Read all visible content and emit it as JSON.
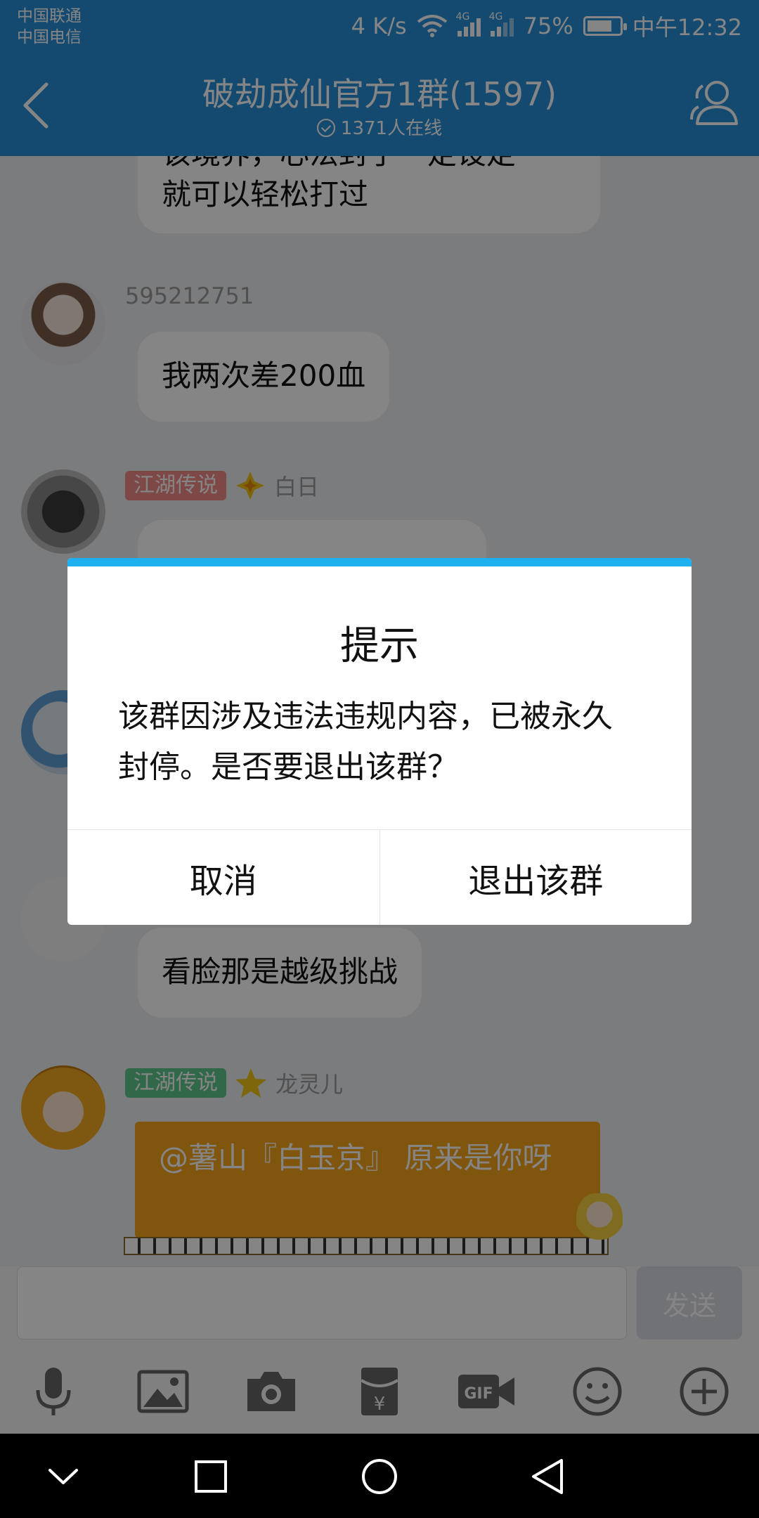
{
  "status_bar": {
    "carrier_1": "中国联通",
    "carrier_2": "中国电信",
    "speed": "4 K/s",
    "network_1": "4G",
    "network_2": "4G",
    "battery": "75%",
    "time": "中午12:32"
  },
  "header": {
    "title": "破劫成仙官方1群(1597)",
    "online": "1371人在线"
  },
  "chat": {
    "prev_message_tail": "该境界，心法封了一定设定\n就可以轻松打过",
    "messages": [
      {
        "sender": "595212751",
        "text": "我两次差200血"
      },
      {
        "tag": "江湖传说",
        "sender": "白日"
      },
      {
        "text": "看脸那是越级挑战"
      },
      {
        "tag": "江湖传说",
        "sender": "龙灵儿",
        "text": "@薯山『白玉京』 原来是你呀"
      }
    ]
  },
  "input": {
    "send_label": "发送"
  },
  "dialog": {
    "title": "提示",
    "message": "该群因涉及违法违规内容，已被永久封停。是否要退出该群？",
    "cancel": "取消",
    "confirm": "退出该群"
  },
  "colors": {
    "header_blue": "#2a8fd6",
    "dialog_accent": "#1fb1ef",
    "tag_red": "#f08a84",
    "tag_green": "#5ec88d",
    "highlight_bubble": "#f6a31c"
  },
  "icons": {
    "toolbar": [
      "microphone-icon",
      "image-icon",
      "camera-icon",
      "red-packet-icon",
      "gif-icon",
      "emoji-icon",
      "plus-icon"
    ],
    "nav": [
      "chevron-down-icon",
      "recents-square-icon",
      "home-circle-icon",
      "back-triangle-icon"
    ]
  }
}
